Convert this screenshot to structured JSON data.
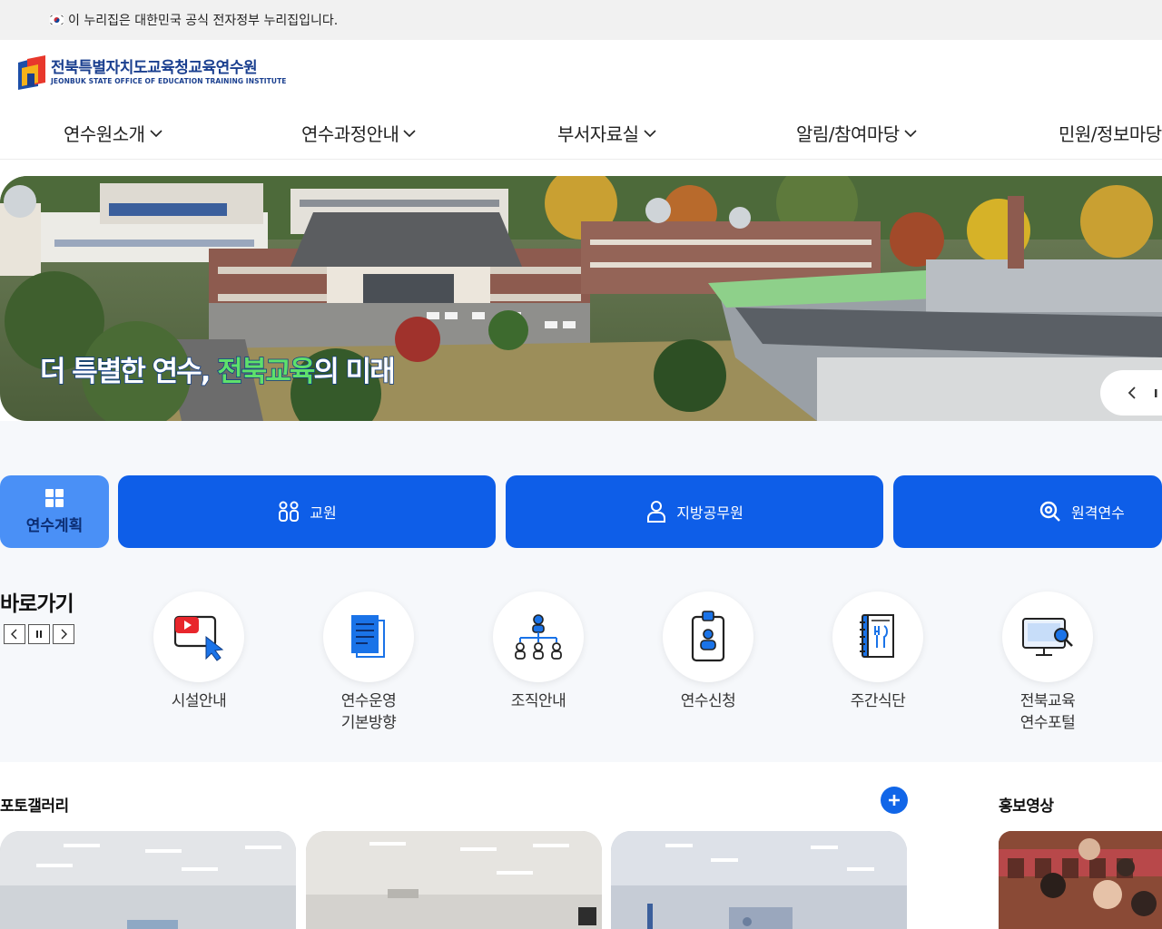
{
  "gov_banner": {
    "text": "이 누리집은 대한민국 공식 전자정부 누리집입니다."
  },
  "logo": {
    "name_ko": "전북특별자치도교육청교육연수원",
    "name_en": "JEONBUK STATE OFFICE OF EDUCATION TRAINING INSTITUTE"
  },
  "gnb": [
    {
      "label": "연수원소개"
    },
    {
      "label": "연수과정안내"
    },
    {
      "label": "부서자료실"
    },
    {
      "label": "알림/참여마당"
    },
    {
      "label": "민원/정보마당"
    }
  ],
  "hero": {
    "slogan_white_1": "더 특별한 연수, ",
    "slogan_green": "전북교육",
    "slogan_white_2": "의 미래"
  },
  "plan_tab": {
    "label": "연수계획"
  },
  "categories": [
    {
      "label": "교원",
      "icon": "people-icon"
    },
    {
      "label": "지방공무원",
      "icon": "person-icon"
    },
    {
      "label": "원격연수",
      "icon": "search-icon"
    }
  ],
  "quick": {
    "title": "바로가기",
    "items": [
      {
        "label": "시설안내",
        "icon": "video-cursor-icon"
      },
      {
        "label": "연수운영\n기본방향",
        "icon": "document-icon"
      },
      {
        "label": "조직안내",
        "icon": "org-chart-icon"
      },
      {
        "label": "연수신청",
        "icon": "id-badge-icon"
      },
      {
        "label": "주간식단",
        "icon": "menu-book-icon"
      },
      {
        "label": "전북교육\n연수포털",
        "icon": "monitor-search-icon"
      }
    ]
  },
  "gallery": {
    "title": "포토갤러리"
  },
  "promo": {
    "title": "홍보영상"
  },
  "colors": {
    "primary": "#0e5ee8",
    "light_blue": "#4a90f6",
    "navy": "#1a3f8f"
  }
}
